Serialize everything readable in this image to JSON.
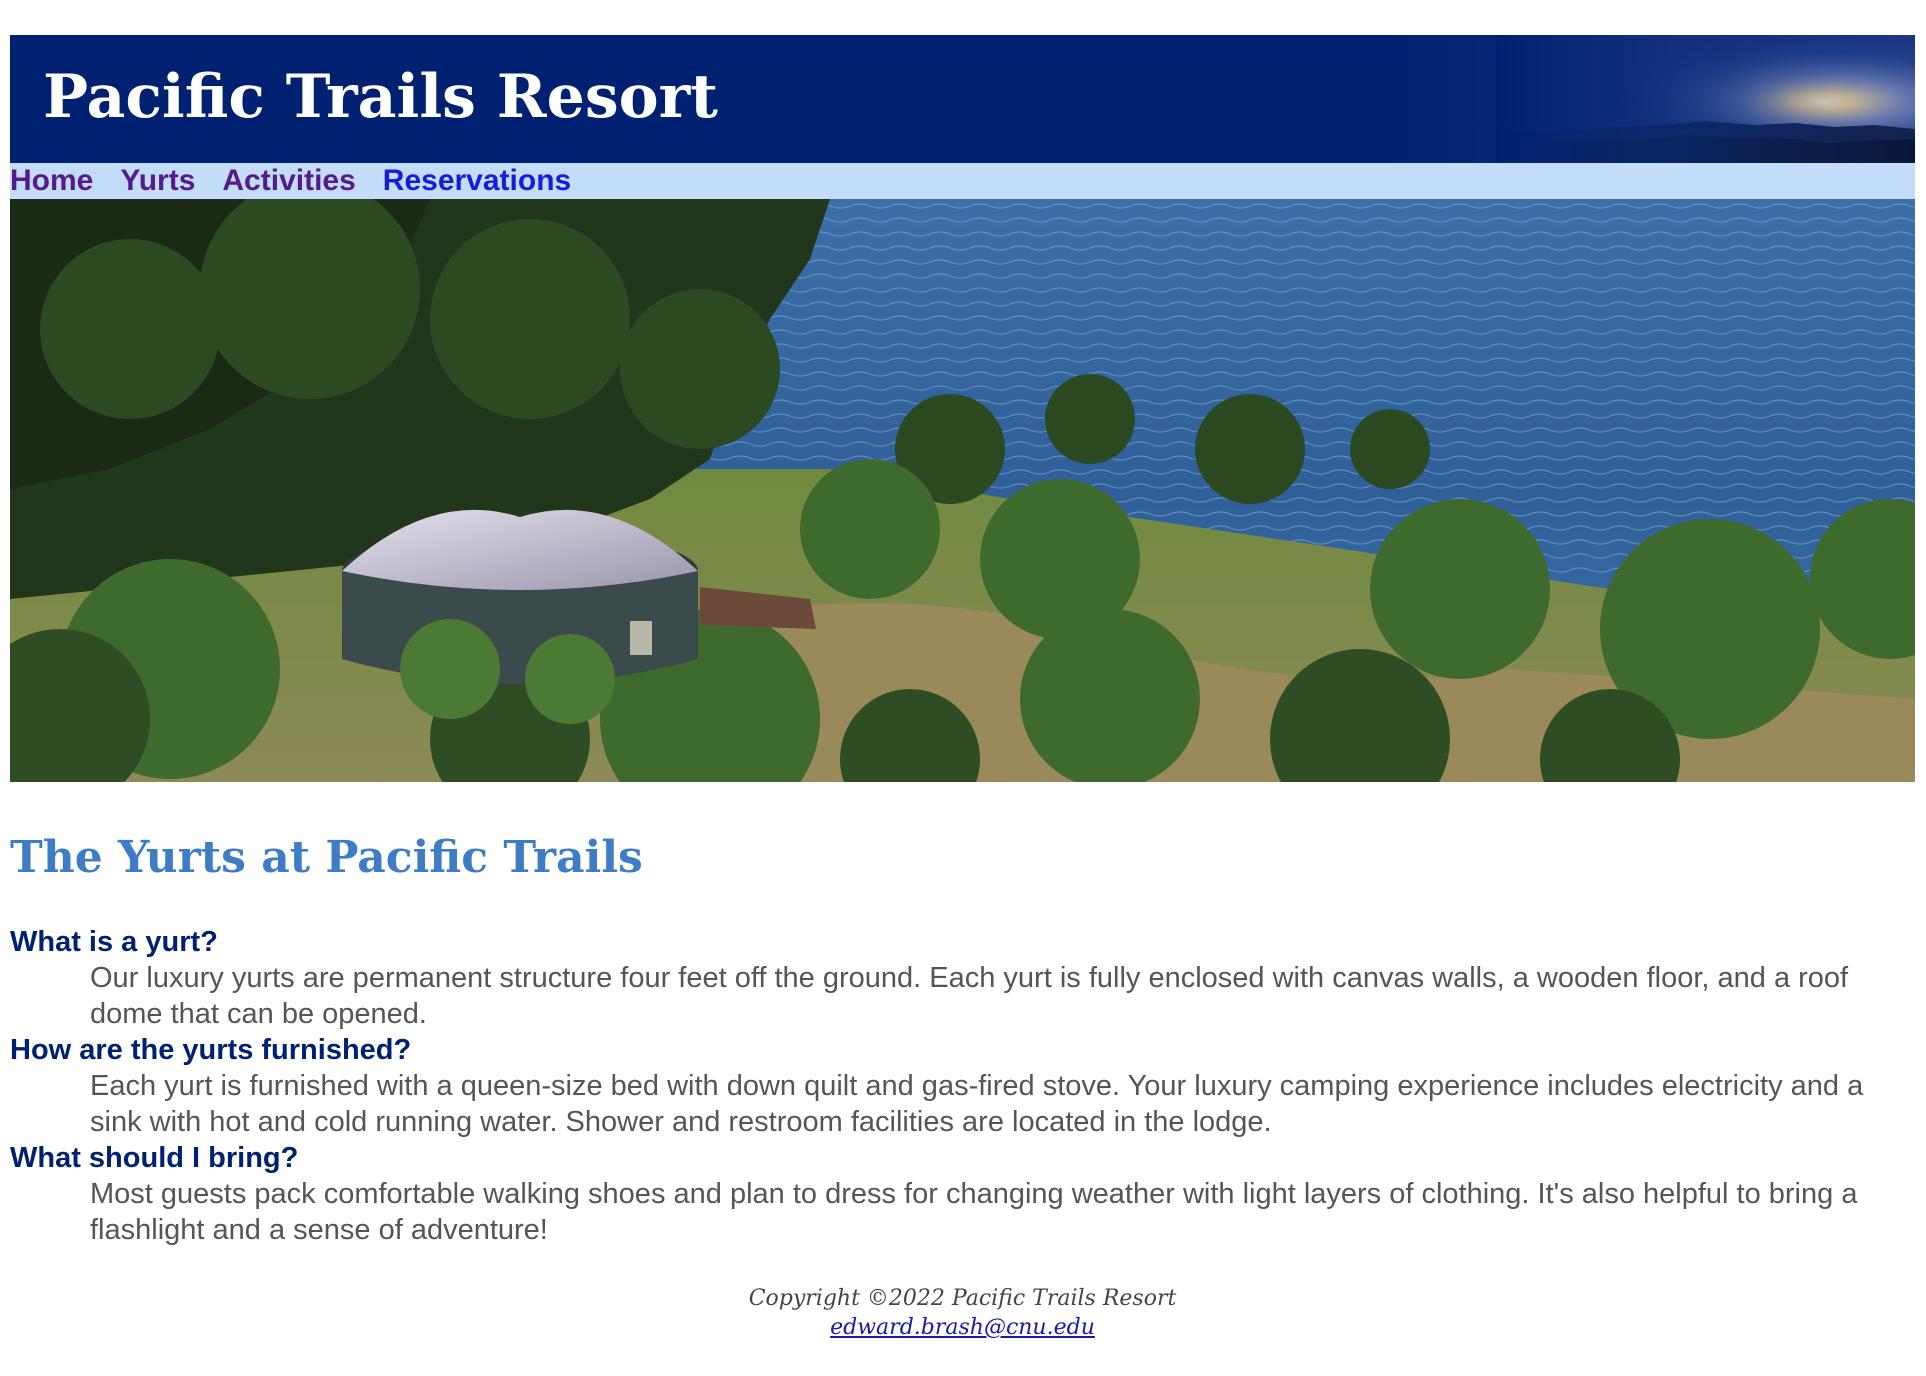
{
  "header": {
    "title": "Pacific Trails Resort"
  },
  "nav": {
    "items": [
      {
        "label": "Home"
      },
      {
        "label": "Yurts"
      },
      {
        "label": "Activities"
      },
      {
        "label": "Reservations"
      }
    ]
  },
  "main": {
    "heading": "The Yurts at Pacific Trails",
    "faq": [
      {
        "question": "What is a yurt?",
        "answer": "Our luxury yurts are permanent structure four feet off the ground. Each yurt is fully enclosed with canvas walls, a wooden floor, and a roof dome that can be opened."
      },
      {
        "question": "How are the yurts furnished?",
        "answer": "Each yurt is furnished with a queen-size bed with down quilt and gas-fired stove. Your luxury camping experience includes electricity and a sink with hot and cold running water. Shower and restroom facilities are located in the lodge."
      },
      {
        "question": "What should I bring?",
        "answer": "Most guests pack comfortable walking shoes and plan to dress for changing weather with light layers of clothing. It's also helpful to bring a flashlight and a sense of adventure!"
      }
    ]
  },
  "footer": {
    "copyright": "Copyright ©2022 Pacific Trails Resort",
    "email": "edward.brash@cnu.edu"
  },
  "colors": {
    "header_bg": "#002171",
    "nav_bg": "#c3dcf7",
    "heading": "#3f7cc6",
    "question": "#002171",
    "visited_link": "#551a8b",
    "active_link": "#1a1ade"
  }
}
